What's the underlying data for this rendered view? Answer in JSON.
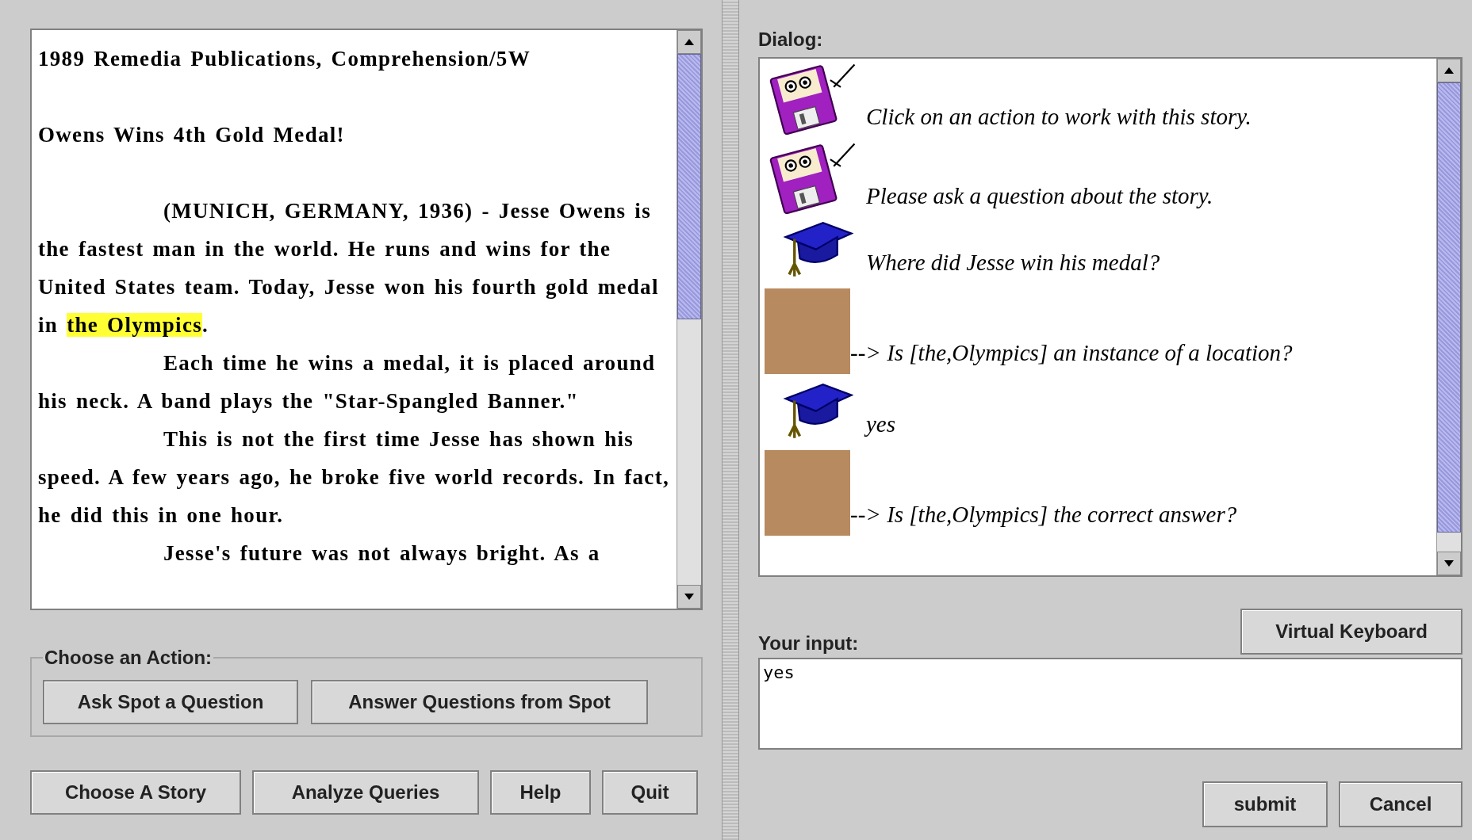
{
  "story": {
    "source": "1989 Remedia Publications, Comprehension/5W",
    "headline": "Owens Wins 4th Gold Medal!",
    "paragraphs": [
      {
        "before": "(MUNICH, GERMANY, 1936) - Jesse Owens is the fastest man in the world.  He runs and wins for the United States team.  Today, Jesse won his fourth gold medal in ",
        "highlight": "the Olympics",
        "after": "."
      },
      {
        "before": "Each time he wins a medal, it is placed around his neck.  A band plays the \"Star-Spangled Banner.\""
      },
      {
        "before": "This is not the first time Jesse has shown his speed.  A few years ago, he broke five world records.  In fact, he did this in one hour."
      },
      {
        "before": "Jesse's future was not always bright.  As a"
      }
    ]
  },
  "actions": {
    "legend": "Choose an Action:",
    "buttons": [
      "Ask Spot a Question",
      "Answer Questions from Spot"
    ]
  },
  "bottom_buttons": [
    "Choose A Story",
    "Analyze Queries",
    "Help",
    "Quit"
  ],
  "dialog": {
    "label": "Dialog:",
    "entries": [
      {
        "kind": "tutor",
        "text": "Click on an action to work with this story."
      },
      {
        "kind": "tutor",
        "text": "Please ask a question about the story."
      },
      {
        "kind": "student",
        "text": "Where did Jesse win his medal?"
      },
      {
        "kind": "system",
        "text": "--> Is [the,Olympics] an instance of a location?"
      },
      {
        "kind": "student",
        "text": "yes"
      },
      {
        "kind": "system",
        "text": "--> Is [the,Olympics] the correct answer?"
      }
    ]
  },
  "input": {
    "label": "Your input:",
    "value": "yes",
    "keyboard_button": "Virtual Keyboard"
  },
  "dialog_buttons": [
    "submit",
    "Cancel"
  ]
}
